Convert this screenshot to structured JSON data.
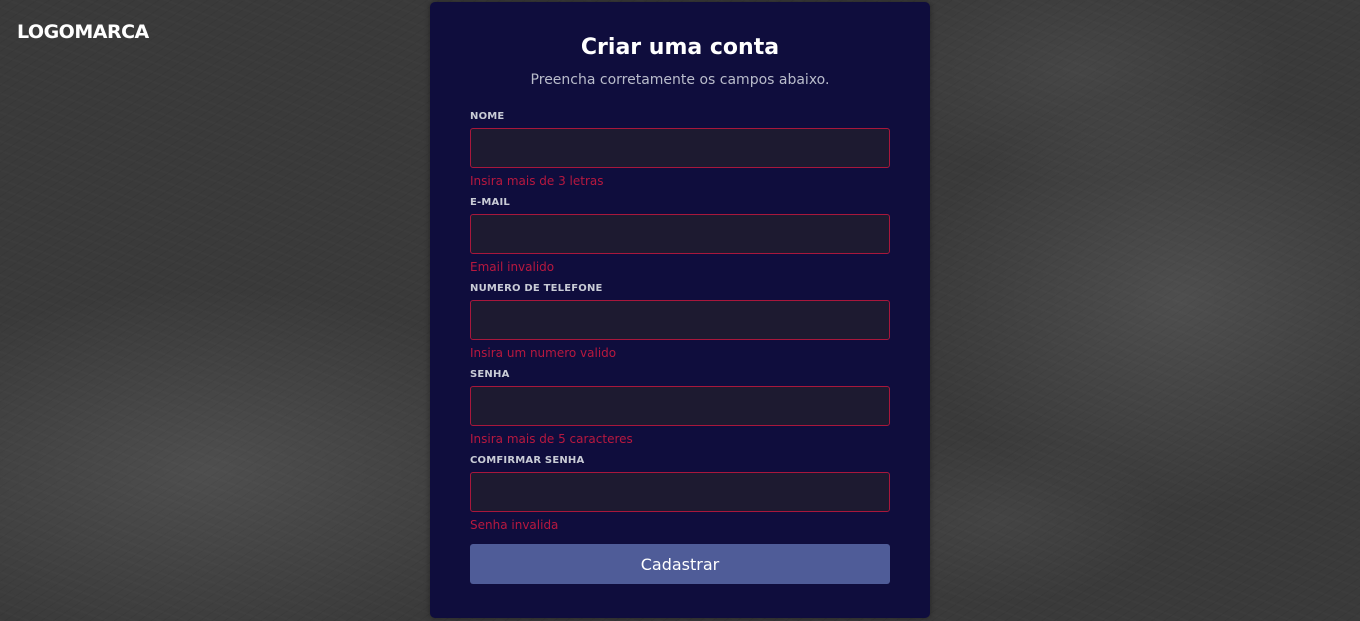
{
  "header": {
    "logo": "LOGOMARCA"
  },
  "form": {
    "title": "Criar uma conta",
    "subtitle": "Preencha corretamente os campos abaixo.",
    "fields": [
      {
        "label": "NOME",
        "value": "",
        "error": "Insira mais de 3 letras"
      },
      {
        "label": "E-MAIL",
        "value": "",
        "error": "Email invalido"
      },
      {
        "label": "NUMERO DE TELEFONE",
        "value": "",
        "error": "Insira um numero valido"
      },
      {
        "label": "SENHA",
        "value": "",
        "error": "Insira mais de 5 caracteres"
      },
      {
        "label": "COMFIRMAR SENHA",
        "value": "",
        "error": "Senha invalida"
      }
    ],
    "submit_label": "Cadastrar"
  },
  "colors": {
    "card_background": "#0f0d3d",
    "input_background": "#1d1a30",
    "error": "#b8183f",
    "button": "#4f5c98"
  }
}
